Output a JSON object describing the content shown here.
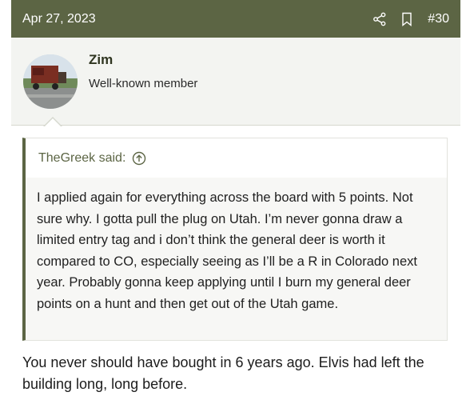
{
  "post": {
    "date": "Apr 27, 2023",
    "number": "#30",
    "icons": [
      "share-icon",
      "bookmark-icon"
    ]
  },
  "user": {
    "name": "Zim",
    "title": "Well-known member"
  },
  "quote": {
    "author": "TheGreek said:",
    "body": "I applied again for everything across the board with 5 points. Not sure why. I gotta pull the plug on Utah. I’m never gonna draw a limited entry tag and i don’t think the general deer is worth it compared to CO, especially seeing as I’ll be a R in Colorado next year. Probably gonna keep applying until I burn my general deer points on a hunt and then get out of the Utah game."
  },
  "reply": {
    "text": "You never should have bought in 6 years ago. Elvis had left the building long, long before."
  },
  "colors": {
    "header_bg": "#5c6544",
    "accent": "#5c6544"
  }
}
